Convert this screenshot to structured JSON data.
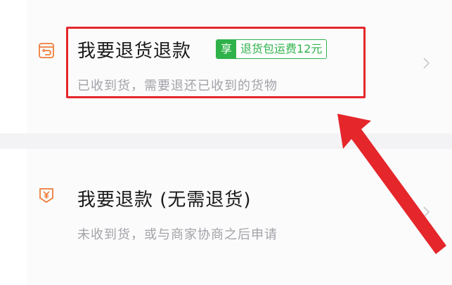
{
  "options": [
    {
      "title": "我要退货退款",
      "subtitle": "已收到货，需要退还已收到的货物",
      "badge": {
        "tag": "享",
        "text": "退货包运费12元"
      }
    },
    {
      "title": "我要退款 (无需退货)",
      "subtitle": "未收到货，或与商家协商之后申请"
    }
  ],
  "colors": {
    "accent_green": "#2fb24a",
    "icon_orange": "#ef7d3a",
    "highlight_red": "#e5262b",
    "subtitle_gray": "#a3a3a8"
  },
  "icons": {
    "option_1": "return-box-icon",
    "option_2": "yen-tag-icon",
    "chevron": "chevron-right-icon"
  }
}
